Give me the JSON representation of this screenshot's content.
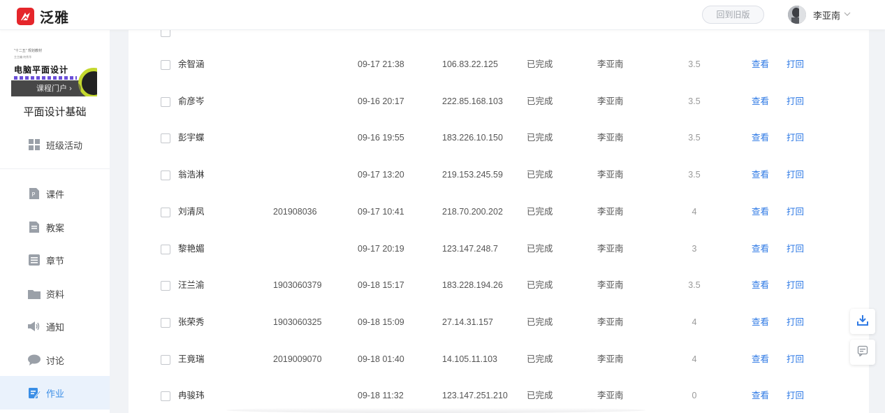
{
  "header": {
    "logo_text": "泛雅",
    "back_button": "回到旧版",
    "user_name": "李亚南"
  },
  "sidebar": {
    "cover": {
      "tag": "\"十二五\" 规划教材",
      "subtitle": "主主编 何秀华",
      "title": "电脑平面设计",
      "portal_label": "课程门户"
    },
    "course_name": "平面设计基础",
    "items": [
      {
        "label": "班级活动",
        "icon": "grid-icon"
      },
      {
        "label": "课件",
        "icon": "ppt-icon"
      },
      {
        "label": "教案",
        "icon": "lesson-plan-icon"
      },
      {
        "label": "章节",
        "icon": "list-icon"
      },
      {
        "label": "资料",
        "icon": "folder-icon"
      },
      {
        "label": "通知",
        "icon": "speaker-icon"
      },
      {
        "label": "讨论",
        "icon": "chat-icon"
      },
      {
        "label": "作业",
        "icon": "homework-icon"
      }
    ],
    "active_item": "作业",
    "accent_color": "#3a8ee6"
  },
  "table": {
    "view_label": "查看",
    "return_label": "打回",
    "rows": [
      {
        "name": "余智涵",
        "id": "",
        "time": "09-17 21:38",
        "ip": "106.83.22.125",
        "status": "已完成",
        "teacher": "李亚南",
        "score": "3.5"
      },
      {
        "name": "俞彦岑",
        "id": "",
        "time": "09-16 20:17",
        "ip": "222.85.168.103",
        "status": "已完成",
        "teacher": "李亚南",
        "score": "3.5"
      },
      {
        "name": "彭宇蝶",
        "id": "",
        "time": "09-16 19:55",
        "ip": "183.226.10.150",
        "status": "已完成",
        "teacher": "李亚南",
        "score": "3.5"
      },
      {
        "name": "翁浩淋",
        "id": "",
        "time": "09-17 13:20",
        "ip": "219.153.245.59",
        "status": "已完成",
        "teacher": "李亚南",
        "score": "3.5"
      },
      {
        "name": "刘清凤",
        "id": "201908036",
        "time": "09-17 10:41",
        "ip": "218.70.200.202",
        "status": "已完成",
        "teacher": "李亚南",
        "score": "4"
      },
      {
        "name": "黎艳媚",
        "id": "",
        "time": "09-17 20:19",
        "ip": "123.147.248.7",
        "status": "已完成",
        "teacher": "李亚南",
        "score": "3"
      },
      {
        "name": "汪兰渝",
        "id": "1903060379",
        "time": "09-18 15:17",
        "ip": "183.228.194.26",
        "status": "已完成",
        "teacher": "李亚南",
        "score": "3.5"
      },
      {
        "name": "张荣秀",
        "id": "1903060325",
        "time": "09-18 15:09",
        "ip": "27.14.31.157",
        "status": "已完成",
        "teacher": "李亚南",
        "score": "4"
      },
      {
        "name": "王竟瑞",
        "id": "2019009070",
        "time": "09-18 01:40",
        "ip": "14.105.11.103",
        "status": "已完成",
        "teacher": "李亚南",
        "score": "4"
      },
      {
        "name": "冉骏玮",
        "id": "",
        "time": "09-18 11:32",
        "ip": "123.147.251.210",
        "status": "已完成",
        "teacher": "李亚南",
        "score": "0"
      }
    ],
    "link_color": "#2f7ae5"
  },
  "floating_tools": [
    {
      "icon": "download-icon"
    },
    {
      "icon": "feedback-icon"
    }
  ]
}
